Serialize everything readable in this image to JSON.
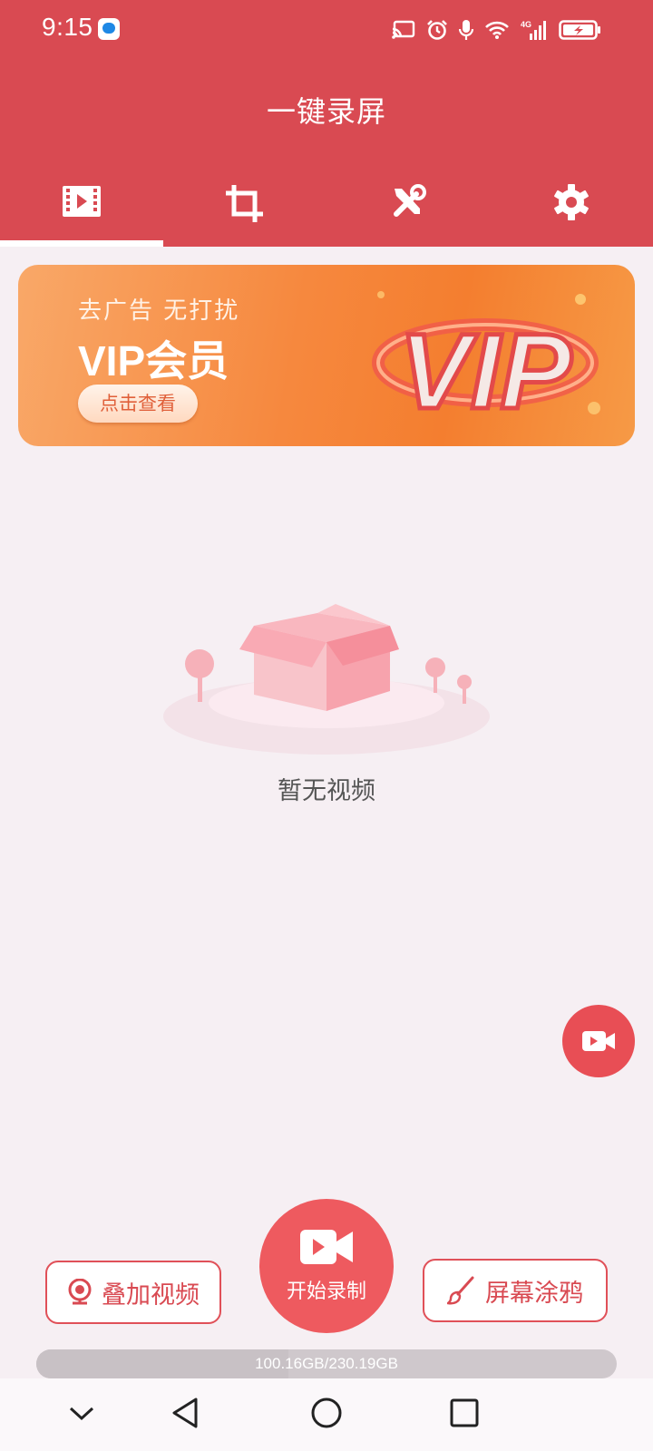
{
  "status_bar": {
    "time": "9:15",
    "network": "4G"
  },
  "header": {
    "title": "一键录屏",
    "color": "#d94a52"
  },
  "tabs": [
    {
      "icon": "video-list-icon",
      "active": true
    },
    {
      "icon": "crop-icon",
      "active": false
    },
    {
      "icon": "tools-icon",
      "active": false
    },
    {
      "icon": "gear-icon",
      "active": false
    }
  ],
  "vip_banner": {
    "subtitle": "去广告  无打扰",
    "title": "VIP会员",
    "button": "点击查看",
    "badge": "VIP"
  },
  "empty_state": {
    "text": "暂无视频"
  },
  "actions": {
    "overlay_video": "叠加视频",
    "start_record": "开始录制",
    "doodle": "屏幕涂鸦"
  },
  "storage": {
    "text": "100.16GB/230.19GB",
    "used_fraction": 0.435
  }
}
